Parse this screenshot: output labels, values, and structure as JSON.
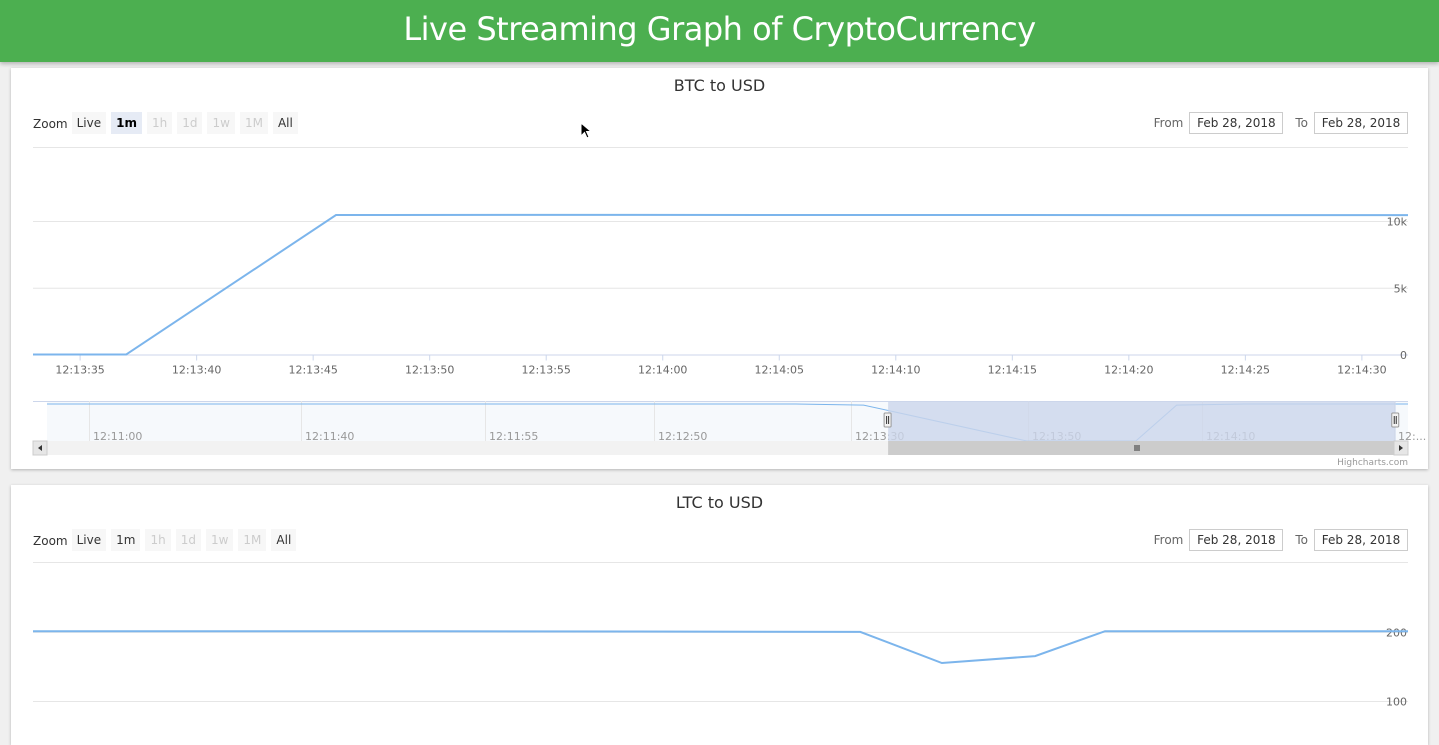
{
  "header": {
    "title": "Live Streaming Graph of CryptoCurrency"
  },
  "zoom": {
    "label": "Zoom",
    "buttons": [
      {
        "label": "Live",
        "state": "normal"
      },
      {
        "label": "1m",
        "state": "normal"
      },
      {
        "label": "1h",
        "state": "disabled"
      },
      {
        "label": "1d",
        "state": "disabled"
      },
      {
        "label": "1w",
        "state": "disabled"
      },
      {
        "label": "1M",
        "state": "disabled"
      },
      {
        "label": "All",
        "state": "normal"
      }
    ]
  },
  "range": {
    "from_label": "From",
    "to_label": "To",
    "from_value": "Feb 28, 2018",
    "to_value": "Feb 28, 2018"
  },
  "credits": "Highcharts.com",
  "colors": {
    "header": "#4caf50",
    "series": "#7cb5ec",
    "navigator_mask": "#ccd6eb"
  },
  "chart_data": [
    {
      "type": "line",
      "title": "BTC to USD",
      "selected_zoom": "1m",
      "x_ticks": [
        "12:13:35",
        "12:13:40",
        "12:13:45",
        "12:13:50",
        "12:13:55",
        "12:14:00",
        "12:14:05",
        "12:14:10",
        "12:14:15",
        "12:14:20",
        "12:14:25",
        "12:14:30"
      ],
      "x_range_seconds": [
        -2.0,
        57.0
      ],
      "y_ticks": [
        "0",
        "5k",
        "10k"
      ],
      "ylim": [
        0,
        10600
      ],
      "grid": true,
      "series": [
        {
          "x": [
            -2.0,
            2.0,
            11.0,
            20.0,
            35.0,
            50.0,
            57.0
          ],
          "y": [
            0,
            0,
            10450,
            10460,
            10450,
            10440,
            10440
          ]
        }
      ],
      "navigator": {
        "x_ticks": [
          "12:11:00",
          "12:11:40",
          "12:11:55",
          "12:12:50",
          "12:13:30",
          "12:13:50",
          "12:14:10",
          "12:..."
        ],
        "series_y_fraction": [
          [
            0,
            1
          ],
          [
            0.55,
            1
          ],
          [
            0.6,
            0.97
          ],
          [
            0.72,
            0
          ],
          [
            0.8,
            0
          ],
          [
            0.83,
            0.97
          ],
          [
            0.88,
            1
          ],
          [
            1,
            1
          ]
        ],
        "selected_range_fraction": [
          0.618,
          0.991
        ]
      }
    },
    {
      "type": "line",
      "title": "LTC to USD",
      "selected_zoom": "",
      "x_ticks": [],
      "y_ticks": [
        "100",
        "200"
      ],
      "ylim": [
        0,
        210
      ],
      "grid": true,
      "series": [
        {
          "x": [
            -2.0,
            15.0,
            33.5,
            37.0,
            41.0,
            44.0,
            57.0
          ],
          "y": [
            201,
            201,
            200,
            155,
            165,
            201,
            201
          ]
        }
      ]
    }
  ]
}
